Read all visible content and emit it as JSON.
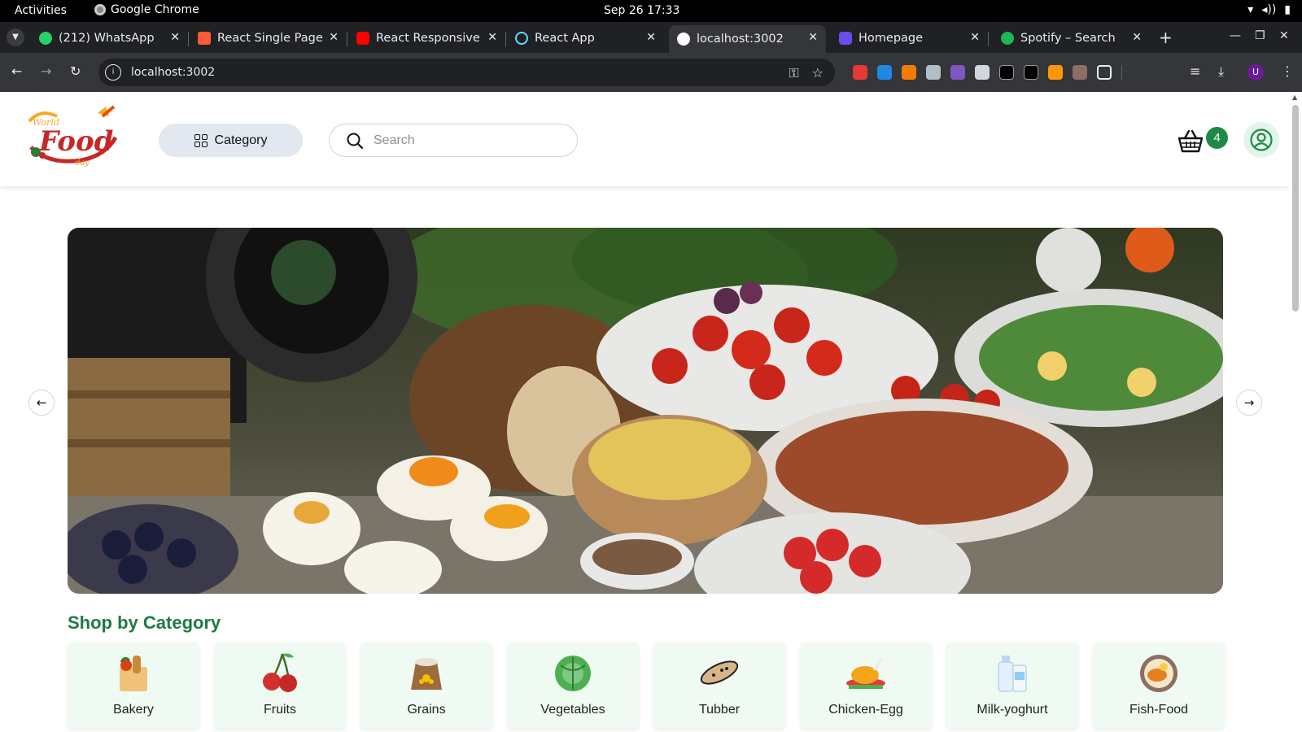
{
  "os_bar": {
    "activities": "Activities",
    "app_name": "Google Chrome",
    "clock": "Sep 26  17:33"
  },
  "browser": {
    "tabs": [
      {
        "label": "(212) WhatsApp",
        "favicon_color": "#25d366",
        "active": false
      },
      {
        "label": "React Single Page",
        "favicon_color": "#ff5a36",
        "active": false
      },
      {
        "label": "React Responsive",
        "favicon_color": "#ff0000",
        "active": false
      },
      {
        "label": "React App",
        "favicon_color": "#61dafb",
        "active": false
      },
      {
        "label": "localhost:3002",
        "favicon_color": "#ffffff",
        "active": true
      },
      {
        "label": "Homepage",
        "favicon_color": "#6c4cf1",
        "active": false
      },
      {
        "label": "Spotify – Search",
        "favicon_color": "#1db954",
        "active": false
      }
    ],
    "address": "localhost:3002",
    "profile_initial": "U",
    "extension_colors": [
      "#e53935",
      "#1e88e5",
      "#f57c00",
      "#b0bec5",
      "#7e57c2",
      "#cfd8dc",
      "#000000",
      "#000000",
      "#ff9800",
      "#8d6e63"
    ]
  },
  "site": {
    "logo_alt": "World Food Day logo",
    "category_button": "Category",
    "search_placeholder": "Search",
    "cart_count": "4",
    "brand_green": "#1f8a47",
    "section_title": "Shop by Category",
    "categories": [
      {
        "label": "Bakery",
        "icon": "bakery-bag-icon"
      },
      {
        "label": "Fruits",
        "icon": "cherry-icon"
      },
      {
        "label": "Grains",
        "icon": "grain-sack-icon"
      },
      {
        "label": "Vegetables",
        "icon": "cabbage-icon"
      },
      {
        "label": "Tubber",
        "icon": "yam-icon"
      },
      {
        "label": "Chicken-Egg",
        "icon": "chicken-icon"
      },
      {
        "label": "Milk-yoghurt",
        "icon": "milk-bottle-icon"
      },
      {
        "label": "Fish-Food",
        "icon": "fish-plate-icon"
      }
    ]
  }
}
